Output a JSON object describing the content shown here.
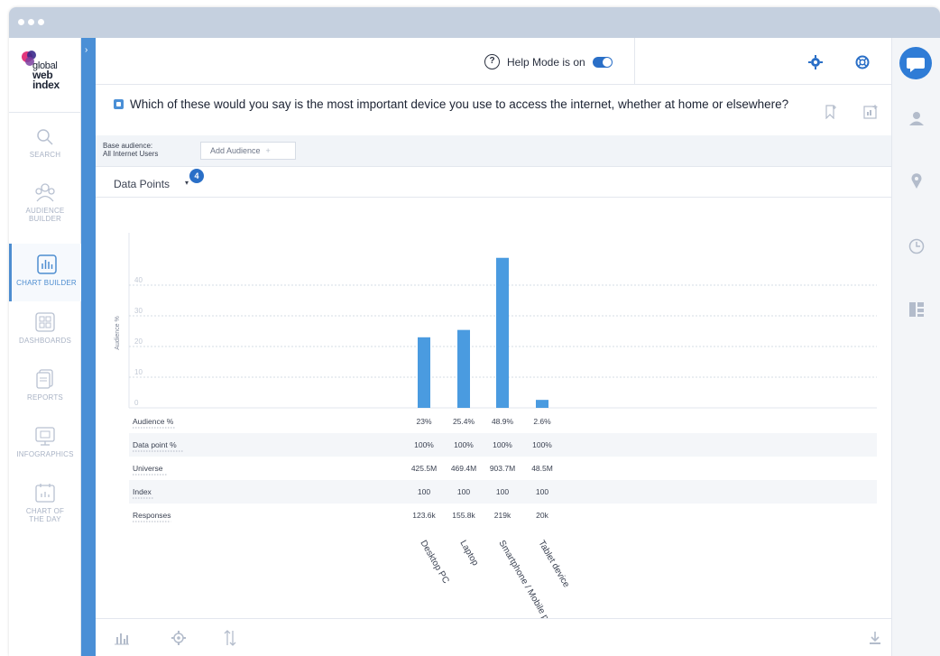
{
  "window": {
    "dots": 3
  },
  "sidebar": {
    "logo": {
      "line1": "global",
      "line2": "web",
      "line3": "index"
    },
    "items": [
      {
        "label": "SEARCH",
        "icon": "search-icon"
      },
      {
        "label": "AUDIENCE",
        "label2": "BUILDER",
        "icon": "audience-icon"
      },
      {
        "label": "CHART BUILDER",
        "icon": "chart-builder-icon",
        "active": true
      },
      {
        "label": "DASHBOARDS",
        "icon": "dashboards-icon"
      },
      {
        "label": "REPORTS",
        "icon": "reports-icon"
      },
      {
        "label": "INFOGRAPHICS",
        "icon": "infographics-icon"
      },
      {
        "label": "CHART OF",
        "label2": "THE DAY",
        "icon": "calendar-icon"
      }
    ]
  },
  "topbar": {
    "help_label": "Help Mode is on",
    "help_mode_on": true
  },
  "question": {
    "text": "Which of these would you say is the most important device you use to access the internet, whether at home or elsewhere?"
  },
  "audience": {
    "base_label": "Base audience:",
    "base_value": "All Internet Users",
    "add_label": "Add Audience",
    "add_plus": "+"
  },
  "data_points": {
    "label": "Data Points",
    "caret": "▾",
    "badge": "4"
  },
  "colors": {
    "accent": "#4a8fd6",
    "bar": "#4a9be0",
    "brand_blue": "#2a6fc7"
  },
  "chart_data": {
    "type": "bar",
    "title": "",
    "xlabel": "",
    "ylabel": "Audience %",
    "ylim": [
      0,
      50
    ],
    "yticks": [
      0,
      10,
      20,
      30,
      40
    ],
    "grid": true,
    "categories": [
      "Desktop PC",
      "Laptop",
      "Smartphone / Mobile phone",
      "Tablet device"
    ],
    "values": [
      23,
      25.4,
      48.9,
      2.6
    ],
    "table": {
      "rows": [
        {
          "label": "Audience %",
          "cells": [
            "23%",
            "25.4%",
            "48.9%",
            "2.6%"
          ]
        },
        {
          "label": "Data point %",
          "cells": [
            "100%",
            "100%",
            "100%",
            "100%"
          ]
        },
        {
          "label": "Universe",
          "cells": [
            "425.5M",
            "469.4M",
            "903.7M",
            "48.5M"
          ]
        },
        {
          "label": "Index",
          "cells": [
            "100",
            "100",
            "100",
            "100"
          ]
        },
        {
          "label": "Responses",
          "cells": [
            "123.6k",
            "155.8k",
            "219k",
            "20k"
          ]
        }
      ]
    }
  }
}
